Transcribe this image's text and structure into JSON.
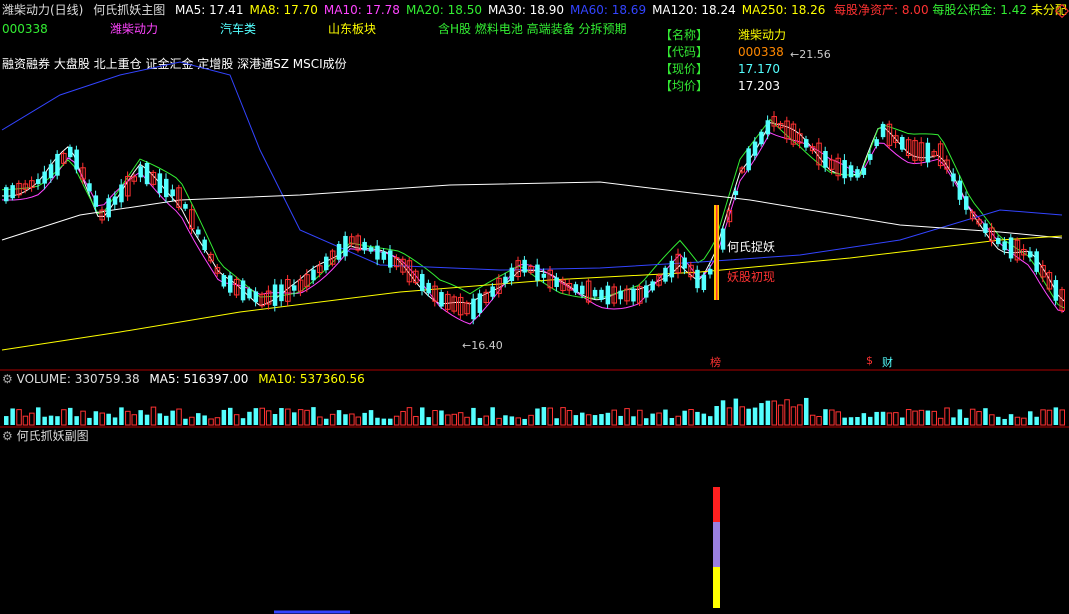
{
  "header": {
    "stock": "潍柴动力(日线)",
    "indicator": "何氏抓妖主图",
    "ma": [
      {
        "label": "MA5: 17.41",
        "color": "#ffffff"
      },
      {
        "label": "MA8: 17.70",
        "color": "#ffff00"
      },
      {
        "label": "MA10: 17.78",
        "color": "#ff44ff"
      },
      {
        "label": "MA20: 18.50",
        "color": "#33ee33"
      },
      {
        "label": "MA30: 18.90",
        "color": "#ffffff"
      },
      {
        "label": "MA60: 18.69",
        "color": "#3344ff"
      },
      {
        "label": "MA120: 18.24",
        "color": "#ffffff"
      },
      {
        "label": "MA250: 18.26",
        "color": "#ffff00"
      }
    ],
    "right_1": "每股净资产: 8.00",
    "right_2": "每股公积金: 1.42",
    "right_3": "未分配"
  },
  "row2": {
    "code": "000338",
    "name": "潍柴动力",
    "sector": "汽车类",
    "region": "山东板块",
    "concepts": "含H股 燃料电池 高端装备 分拆预期"
  },
  "tags": "融资融券 大盘股 北上重仓 证金汇金 定增股 深港通SZ MSCI成份",
  "info_box": {
    "name_key": "【名称】",
    "name_val": "潍柴动力",
    "code_key": "【代码】",
    "code_val": "000338",
    "price_key": "【现价】",
    "price_val": "17.170",
    "avg_key": "【均价】",
    "avg_val": "17.203"
  },
  "annotations": {
    "high": "21.56",
    "low": "16.40",
    "signal_1": "何氏捉妖",
    "signal_2": "妖股初现",
    "badge_1": "榜",
    "badge_2": "$",
    "badge_3": "财"
  },
  "volume_pane": {
    "title": "VOLUME: 330759.38",
    "ma5": "MA5: 516397.00",
    "ma10": "MA10: 537360.56"
  },
  "sub_pane": {
    "title": "何氏抓妖副图"
  },
  "colors": {
    "up": "#ff3232",
    "down": "#54ffff",
    "ma5": "#ffffff",
    "ma10": "#ff44ff",
    "ma20": "#33ee33",
    "ma60": "#3344ff",
    "ma120": "#ffffff",
    "ma250": "#ffff00"
  }
}
